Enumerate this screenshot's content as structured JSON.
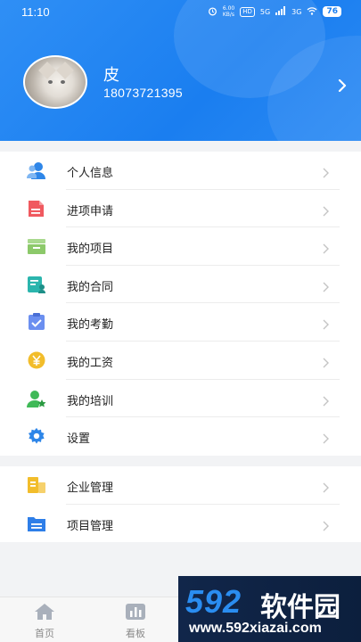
{
  "status_bar": {
    "time": "11:10",
    "net_speed": "6.00\nKB/s",
    "hd": "HD",
    "signal1": "5G",
    "signal2": "3G",
    "battery": "76"
  },
  "profile": {
    "name": "皮",
    "phone": "18073721395"
  },
  "menu_group1": [
    {
      "label": "个人信息",
      "icon": "person-icon",
      "color": "#2e86e8"
    },
    {
      "label": "进项申请",
      "icon": "document-icon",
      "color": "#f0595f"
    },
    {
      "label": "我的项目",
      "icon": "folder-box-icon",
      "color": "#8cc96a"
    },
    {
      "label": "我的合同",
      "icon": "contract-icon",
      "color": "#2bb5ad"
    },
    {
      "label": "我的考勤",
      "icon": "attendance-clipboard-icon",
      "color": "#6b8ff0"
    },
    {
      "label": "我的工资",
      "icon": "yen-coin-icon",
      "color": "#f2bd2b"
    },
    {
      "label": "我的培训",
      "icon": "training-person-star-icon",
      "color": "#3fb957"
    },
    {
      "label": "设置",
      "icon": "gear-icon",
      "color": "#2e86e8"
    }
  ],
  "menu_group2": [
    {
      "label": "企业管理",
      "icon": "enterprise-building-icon",
      "color": "#f2bd2b"
    },
    {
      "label": "项目管理",
      "icon": "project-folder-icon",
      "color": "#2e7ee8"
    }
  ],
  "bottom_nav": [
    {
      "label": "首页",
      "icon": "home-icon"
    },
    {
      "label": "看板",
      "icon": "dashboard-chart-icon"
    }
  ],
  "watermark": {
    "number": "592",
    "brand": "软件园",
    "url": "www.592xiazai.com"
  }
}
